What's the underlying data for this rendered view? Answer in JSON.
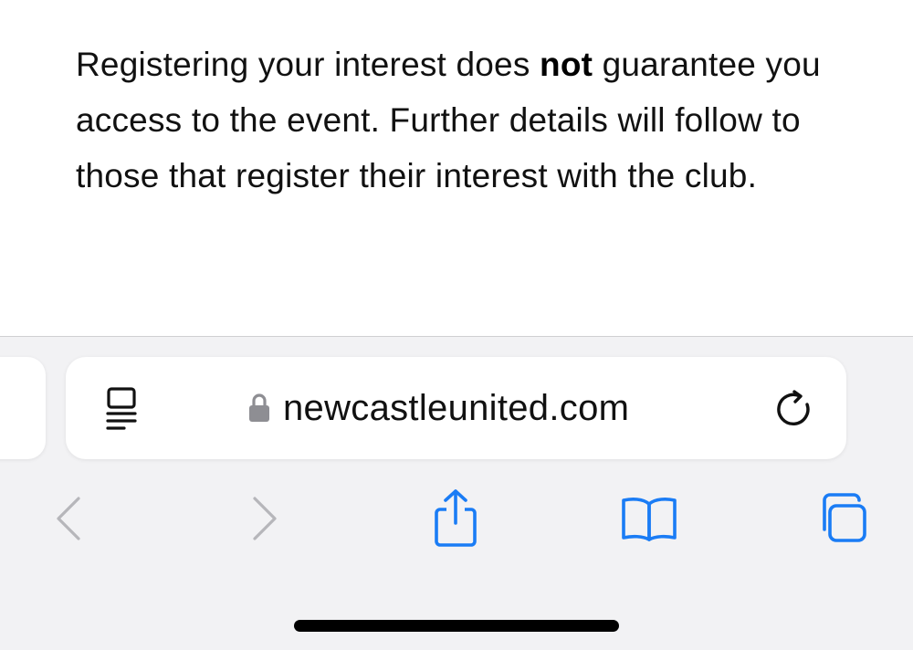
{
  "content": {
    "para_part1": "Registering your interest does ",
    "para_bold": "not",
    "para_part2": " guarantee you access to the event. Further details will follow to those that register their interest with the club."
  },
  "address_bar": {
    "url": "newcastleunited.com"
  },
  "icons": {
    "reader": "reader-mode-icon",
    "lock": "lock-icon",
    "reload": "reload-icon",
    "back": "chevron-left-icon",
    "forward": "chevron-right-icon",
    "share": "share-icon",
    "bookmarks": "book-icon",
    "tabs": "tabs-icon"
  },
  "colors": {
    "accent": "#1a7cf5",
    "disabled": "#b6b6ba",
    "toolbar_bg": "#f2f2f4"
  }
}
